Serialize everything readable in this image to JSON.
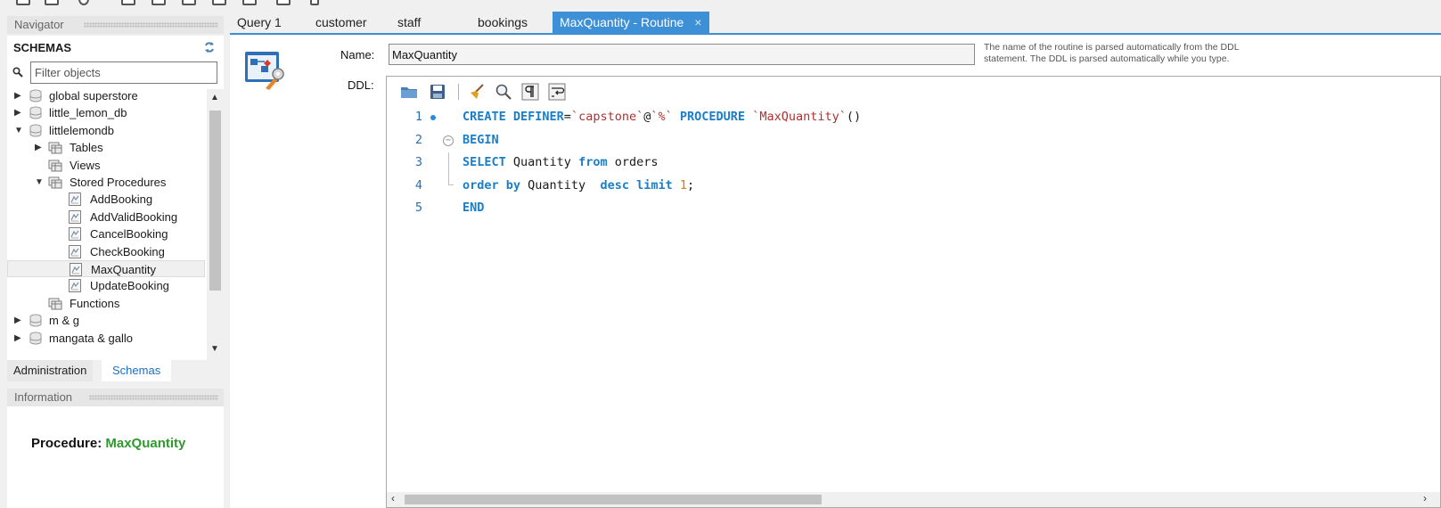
{
  "navigator": {
    "header": "Navigator",
    "schemas_title": "SCHEMAS",
    "filter_placeholder": "Filter objects",
    "tree": [
      {
        "label": "global superstore",
        "type": "schema",
        "arrow": "collapsed"
      },
      {
        "label": "little_lemon_db",
        "type": "schema",
        "arrow": "collapsed"
      },
      {
        "label": "littlelemondb",
        "type": "schema",
        "arrow": "expanded"
      },
      {
        "label": "Tables",
        "type": "folder",
        "arrow": "collapsed"
      },
      {
        "label": "Views",
        "type": "folder",
        "arrow": "none"
      },
      {
        "label": "Stored Procedures",
        "type": "folder",
        "arrow": "expanded"
      },
      {
        "label": "AddBooking",
        "type": "routine",
        "arrow": "none"
      },
      {
        "label": "AddValidBooking",
        "type": "routine",
        "arrow": "none"
      },
      {
        "label": "CancelBooking",
        "type": "routine",
        "arrow": "none"
      },
      {
        "label": "CheckBooking",
        "type": "routine",
        "arrow": "none"
      },
      {
        "label": "MaxQuantity",
        "type": "routine",
        "arrow": "none",
        "selected": true
      },
      {
        "label": "UpdateBooking",
        "type": "routine",
        "arrow": "none"
      },
      {
        "label": "Functions",
        "type": "folder",
        "arrow": "none"
      },
      {
        "label": "m & g",
        "type": "schema",
        "arrow": "collapsed"
      },
      {
        "label": "mangata & gallo",
        "type": "schema",
        "arrow": "collapsed"
      }
    ],
    "bottom_tabs": {
      "administration": "Administration",
      "schemas": "Schemas"
    }
  },
  "information": {
    "header": "Information",
    "label": "Procedure:",
    "name": "MaxQuantity"
  },
  "tabs": [
    {
      "label": "Query 1",
      "active": false
    },
    {
      "label": "customer",
      "active": false
    },
    {
      "label": "staff",
      "active": false
    },
    {
      "label": "bookings",
      "active": false
    },
    {
      "label": "MaxQuantity - Routine",
      "active": true,
      "close": "×"
    }
  ],
  "routine": {
    "name_label": "Name:",
    "name_value": "MaxQuantity",
    "name_hint": "The name of the routine is parsed automatically from the DDL statement. The DDL is parsed automatically while you type.",
    "ddl_label": "DDL:"
  },
  "code_lines": [
    {
      "n": "1",
      "marker": true,
      "fold": false,
      "tokens": [
        {
          "t": "CREATE DEFINER",
          "c": "kw"
        },
        {
          "t": "=",
          "c": "plain"
        },
        {
          "t": "`capstone`",
          "c": "str"
        },
        {
          "t": "@",
          "c": "plain"
        },
        {
          "t": "`%`",
          "c": "str"
        },
        {
          "t": " ",
          "c": "plain"
        },
        {
          "t": "PROCEDURE",
          "c": "kw"
        },
        {
          "t": " ",
          "c": "plain"
        },
        {
          "t": "`MaxQuantity`",
          "c": "str"
        },
        {
          "t": "()",
          "c": "plain"
        }
      ]
    },
    {
      "n": "2",
      "marker": false,
      "fold": true,
      "tokens": [
        {
          "t": "BEGIN",
          "c": "kw"
        }
      ]
    },
    {
      "n": "3",
      "marker": false,
      "fold": false,
      "tokens": [
        {
          "t": "SELECT",
          "c": "kw"
        },
        {
          "t": " Quantity ",
          "c": "plain"
        },
        {
          "t": "from",
          "c": "kw"
        },
        {
          "t": " orders",
          "c": "plain"
        }
      ]
    },
    {
      "n": "4",
      "marker": false,
      "fold": false,
      "tokens": [
        {
          "t": "order by",
          "c": "kw"
        },
        {
          "t": " Quantity  ",
          "c": "plain"
        },
        {
          "t": "desc limit",
          "c": "kw"
        },
        {
          "t": " ",
          "c": "plain"
        },
        {
          "t": "1",
          "c": "num"
        },
        {
          "t": ";",
          "c": "plain"
        }
      ]
    },
    {
      "n": "5",
      "marker": false,
      "fold": false,
      "tokens": [
        {
          "t": "END",
          "c": "kw"
        }
      ]
    }
  ],
  "colors": {
    "accent": "#3d8fd6",
    "keyword": "#1a7ec9",
    "string": "#b03030",
    "number": "#e07a00",
    "info_name": "#2e9a2e"
  }
}
